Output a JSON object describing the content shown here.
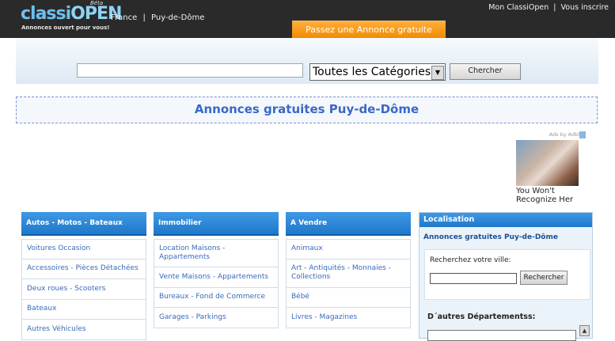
{
  "header": {
    "logo_part1": "classi",
    "logo_part2": "OPEN",
    "beta": "Béta",
    "tagline": "Annonces ouvert pour vous!",
    "breadcrumb": [
      "France",
      "|",
      "Puy-de-Dôme"
    ],
    "links": [
      "Mon ClassiOpen",
      "|",
      "Vous inscrire"
    ],
    "post_button": "Passez une Annonce gratuite"
  },
  "search": {
    "query_value": "",
    "category_selected": "Toutes les Catégories",
    "button": "Chercher"
  },
  "page_title": "Annonces gratuites Puy-de-Dôme",
  "ad": {
    "label": "Ads by Adbl",
    "text_line1": "You Won't",
    "text_line2": "Recognize Her"
  },
  "columns": [
    {
      "title": "Autos - Motos - Bateaux",
      "items": [
        "Voitures Occasion",
        "Accessoires - Pièces Détachées",
        "Deux roues - Scooters",
        "Bateaux",
        "Autres Véhicules"
      ]
    },
    {
      "title": "Immobilier",
      "items": [
        "Location Maisons - Appartements",
        "Vente Maisons - Appartements",
        "Bureaux - Fond de Commerce",
        "Garages - Parkings"
      ]
    },
    {
      "title": "A Vendre",
      "items": [
        "Animaux",
        "Art - Antiquités - Monnaies - Collections",
        "Bébé",
        "Livres - Magazines"
      ]
    }
  ],
  "location": {
    "title": "Localisation",
    "subtitle": "Annonces gratuites Puy-de-Dôme",
    "city_label": "Recherchez votre ville:",
    "city_value": "",
    "city_button": "Rechercher",
    "other_label": "D´autres Départementss:"
  },
  "colors": {
    "header_bg": "#2a2a2a",
    "accent_orange": "#f08a00",
    "column_head_blue": "#1f78c9",
    "link_blue": "#3a6ab8",
    "title_blue": "#3a68c8"
  }
}
